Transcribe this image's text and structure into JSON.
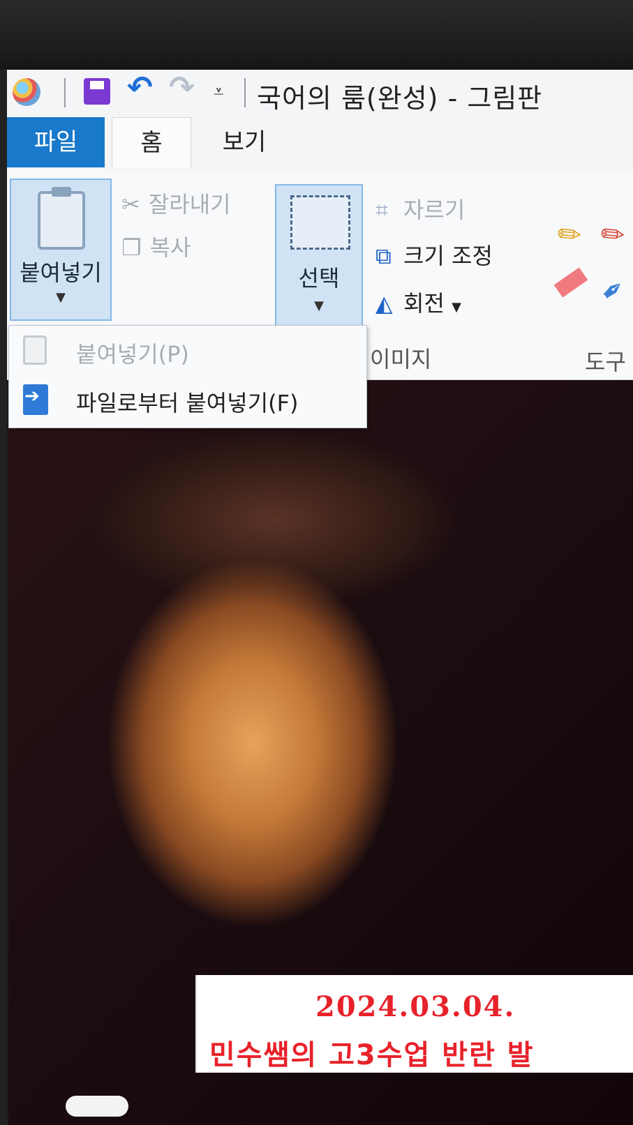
{
  "window": {
    "title": "국어의 룸(완성) - 그림판"
  },
  "quick_access": {
    "icons": [
      "paint-app-icon",
      "save-icon",
      "undo-icon",
      "redo-icon",
      "customize-dropdown-icon"
    ]
  },
  "tabs": [
    {
      "label": "파일"
    },
    {
      "label": "홈"
    },
    {
      "label": "보기"
    }
  ],
  "ribbon": {
    "paste_label": "붙여넣기",
    "cut_label": "잘라내기",
    "copy_label": "복사",
    "select_label": "선택",
    "crop_label": "자르기",
    "resize_label": "크기 조정",
    "rotate_label": "회전",
    "image_group_label": "이미지",
    "tools_group_label": "도구"
  },
  "paste_menu": {
    "items": [
      {
        "label": "붙여넣기(P)",
        "enabled": false
      },
      {
        "label": "파일로부터 붙여넣기(F)",
        "enabled": true
      }
    ]
  },
  "canvas": {
    "caption_date": "2024.03.04.",
    "caption_text": "민수쌤의 고3수업 반란 발"
  },
  "colors": {
    "file_tab": "#1979ca",
    "selected_button": "#cfe3f5",
    "caption_text": "#e8222a"
  }
}
